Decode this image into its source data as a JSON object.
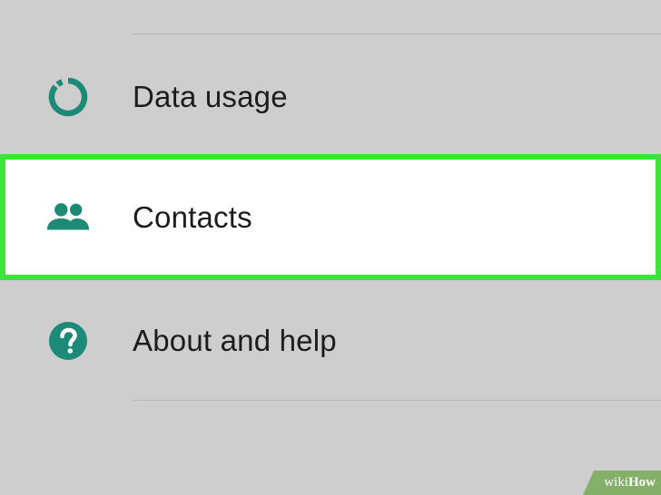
{
  "settings_menu": {
    "items": [
      {
        "label": "Data usage",
        "icon": "data-usage-icon"
      },
      {
        "label": "Contacts",
        "icon": "contacts-icon",
        "highlighted": true
      },
      {
        "label": "About and help",
        "icon": "help-icon"
      }
    ]
  },
  "colors": {
    "background": "#cecece",
    "icon_teal": "#1d8a78",
    "highlight_border": "#3de23a",
    "highlight_fill": "#ffffff",
    "text": "#1c1c1c"
  },
  "watermark": {
    "prefix": "wiki",
    "suffix": "How"
  }
}
